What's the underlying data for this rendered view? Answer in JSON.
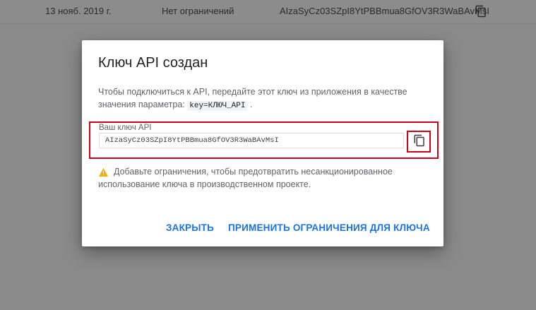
{
  "background_row": {
    "date": "13 нояб. 2019 г.",
    "restrictions": "Нет ограничений",
    "key": "AIzaSyCz03SZpI8YtPBBmua8GfOV3R3WaBAvMsI",
    "copy_icon": "copy-icon"
  },
  "dialog": {
    "title": "Ключ API создан",
    "description_prefix": "Чтобы подключиться к API, передайте этот ключ из приложения в качестве значения параметра:",
    "description_code": "key=КЛЮЧ_API",
    "description_suffix": ".",
    "key_field": {
      "label": "Ваш ключ API",
      "value": "AIzaSyCz03SZpI8YtPBBmua8GfOV3R3WaBAvMsI",
      "copy_icon": "copy-icon"
    },
    "warning": {
      "icon": "warning-icon",
      "text": "Добавьте ограничения, чтобы предотвратить несанкционированное использование ключа в производственном проекте."
    },
    "buttons": {
      "close": "ЗАКРЫТЬ",
      "apply_restrictions": "ПРИМЕНИТЬ ОГРАНИЧЕНИЯ ДЛЯ КЛЮЧА"
    }
  },
  "colors": {
    "accent": "#1a73e8",
    "highlight": "#d0021b",
    "warning": "#f9ab00"
  }
}
